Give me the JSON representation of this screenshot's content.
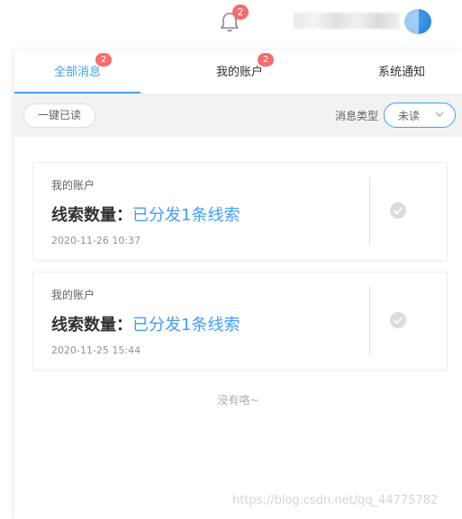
{
  "header": {
    "notification_count": "2"
  },
  "tabs": [
    {
      "label": "全部消息",
      "badge": "2",
      "active": true
    },
    {
      "label": "我的账户",
      "badge": "2",
      "active": false
    },
    {
      "label": "系统通知",
      "badge": "",
      "active": false
    }
  ],
  "toolbar": {
    "mark_all_read_label": "一键已读",
    "filter_label": "消息类型",
    "filter_value": "未读"
  },
  "messages": [
    {
      "category": "我的账户",
      "title_prefix": "线索数量：",
      "title_content": "已分发1条线索",
      "time": "2020-11-26 10:37"
    },
    {
      "category": "我的账户",
      "title_prefix": "线索数量：",
      "title_content": "已分发1条线索",
      "time": "2020-11-25 15:44"
    }
  ],
  "empty_text": "没有咯~",
  "watermark": "https://blog.csdn.net/qq_44775782",
  "colors": {
    "accent": "#409eff",
    "badge": "#f56c6c"
  }
}
